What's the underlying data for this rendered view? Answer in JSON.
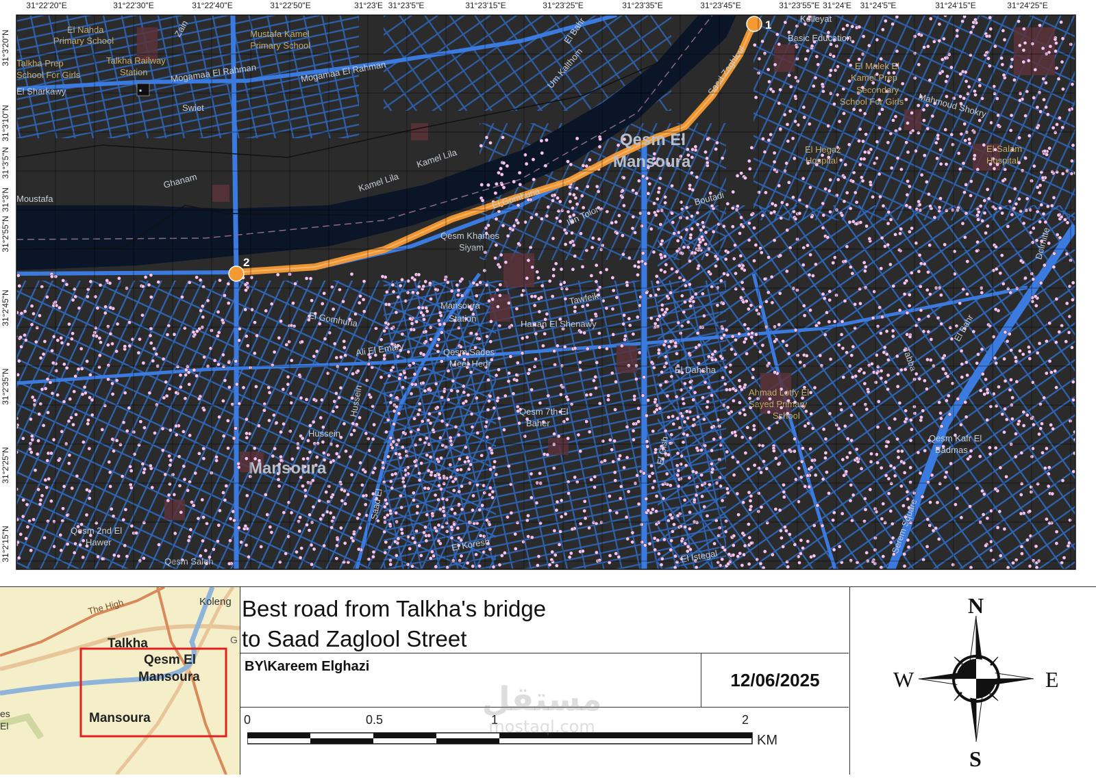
{
  "map": {
    "lon_ticks": [
      "31°22'20\"E",
      "31°22'30\"E",
      "31°22'40\"E",
      "31°22'50\"E",
      "31°23'E",
      "31°23'5\"E",
      "31°23'15\"E",
      "31°23'25\"E",
      "31°23'35\"E",
      "31°23'45\"E",
      "31°23'55\"E",
      "31°24'E",
      "31°24'5\"E",
      "31°24'15\"E",
      "31°24'25\"E"
    ],
    "lat_ticks": [
      "31°3'20\"N",
      "31°3'10\"N",
      "31°3'5\"N",
      "31°3'N",
      "31°2'55\"N",
      "31°2'45\"N",
      "31°2'35\"N",
      "31°2'25\"N",
      "31°2'15\"N"
    ],
    "district_labels": [
      "Qesm El",
      "Mansoura",
      "Mansoura"
    ],
    "street_labels": [
      "Mogamaa El Rahman",
      "Mogamaa El Rahman",
      "Kamel Lila",
      "Kamel Lila",
      "El Gomhuria",
      "Ghanam",
      "Moustafa",
      "Swiet",
      "Zain",
      "El Bahr",
      "Um Kalthom",
      "Saad Zaghloul",
      "Mahmoud Shokry",
      "Boutadi",
      "Ibn Tolon",
      "Tawfeik",
      "Hanan El Shenawy",
      "El Gomhuria",
      "Ali El Emary",
      "Hussein",
      "Saad El",
      "El Gish",
      "El Istegal",
      "Dolmitte",
      "Serem Square",
      "Tabba",
      "El Bahr",
      "El Dahsha",
      "Hussein",
      "El Koresh"
    ],
    "poi_labels": [
      "El Nahda",
      "Primary School",
      "Mustafa Kamel",
      "Primary School",
      "Talkha Prep",
      "School For Girls",
      "Talkha Railway",
      "Station",
      "El Malek El",
      "Kamel Prep",
      "Secondary",
      "School For Girls",
      "El Hegaz",
      "Hospital",
      "El Salam",
      "Hospital",
      "Ahmad Lotfy El",
      "Sayed Primary",
      "School"
    ],
    "area_labels": [
      "Qesm Khames",
      "Siyam",
      "Mansoura",
      "Station",
      "Qesm Sades",
      "Meet Hedr",
      "Qesm 7th El",
      "Baher",
      "Qesm Kafr El",
      "Badmas",
      "Qesm 2nd El",
      "Hawer",
      "Qesm Saleh",
      "El Sharkawy",
      "Kolleyat",
      "Basic Education"
    ],
    "route": {
      "start_label": "1",
      "end_label": "2",
      "color": "#f59a31"
    },
    "colors": {
      "background": "#2b2b2b",
      "water": "#0a1528",
      "roads": "#2f6bc4",
      "points": "#f6c6f0"
    }
  },
  "inset": {
    "labels": [
      "The High",
      "Koleng",
      "Talkha",
      "Qesm El",
      "Mansoura",
      "Mansoura",
      "es",
      "El",
      "G"
    ]
  },
  "legend": {
    "title": "Best road from Talkha's bridge\nto Saad Zaglool Street",
    "author": "BY\\Kareem Elghazi",
    "date": "12/06/2025",
    "scale": {
      "labels": [
        "0",
        "0.5",
        "1",
        "2"
      ],
      "unit": "KM"
    },
    "compass": {
      "n": "N",
      "s": "S",
      "e": "E",
      "w": "W"
    }
  },
  "watermark": {
    "arabic": "مستقل",
    "latin": "mostaql.com"
  }
}
